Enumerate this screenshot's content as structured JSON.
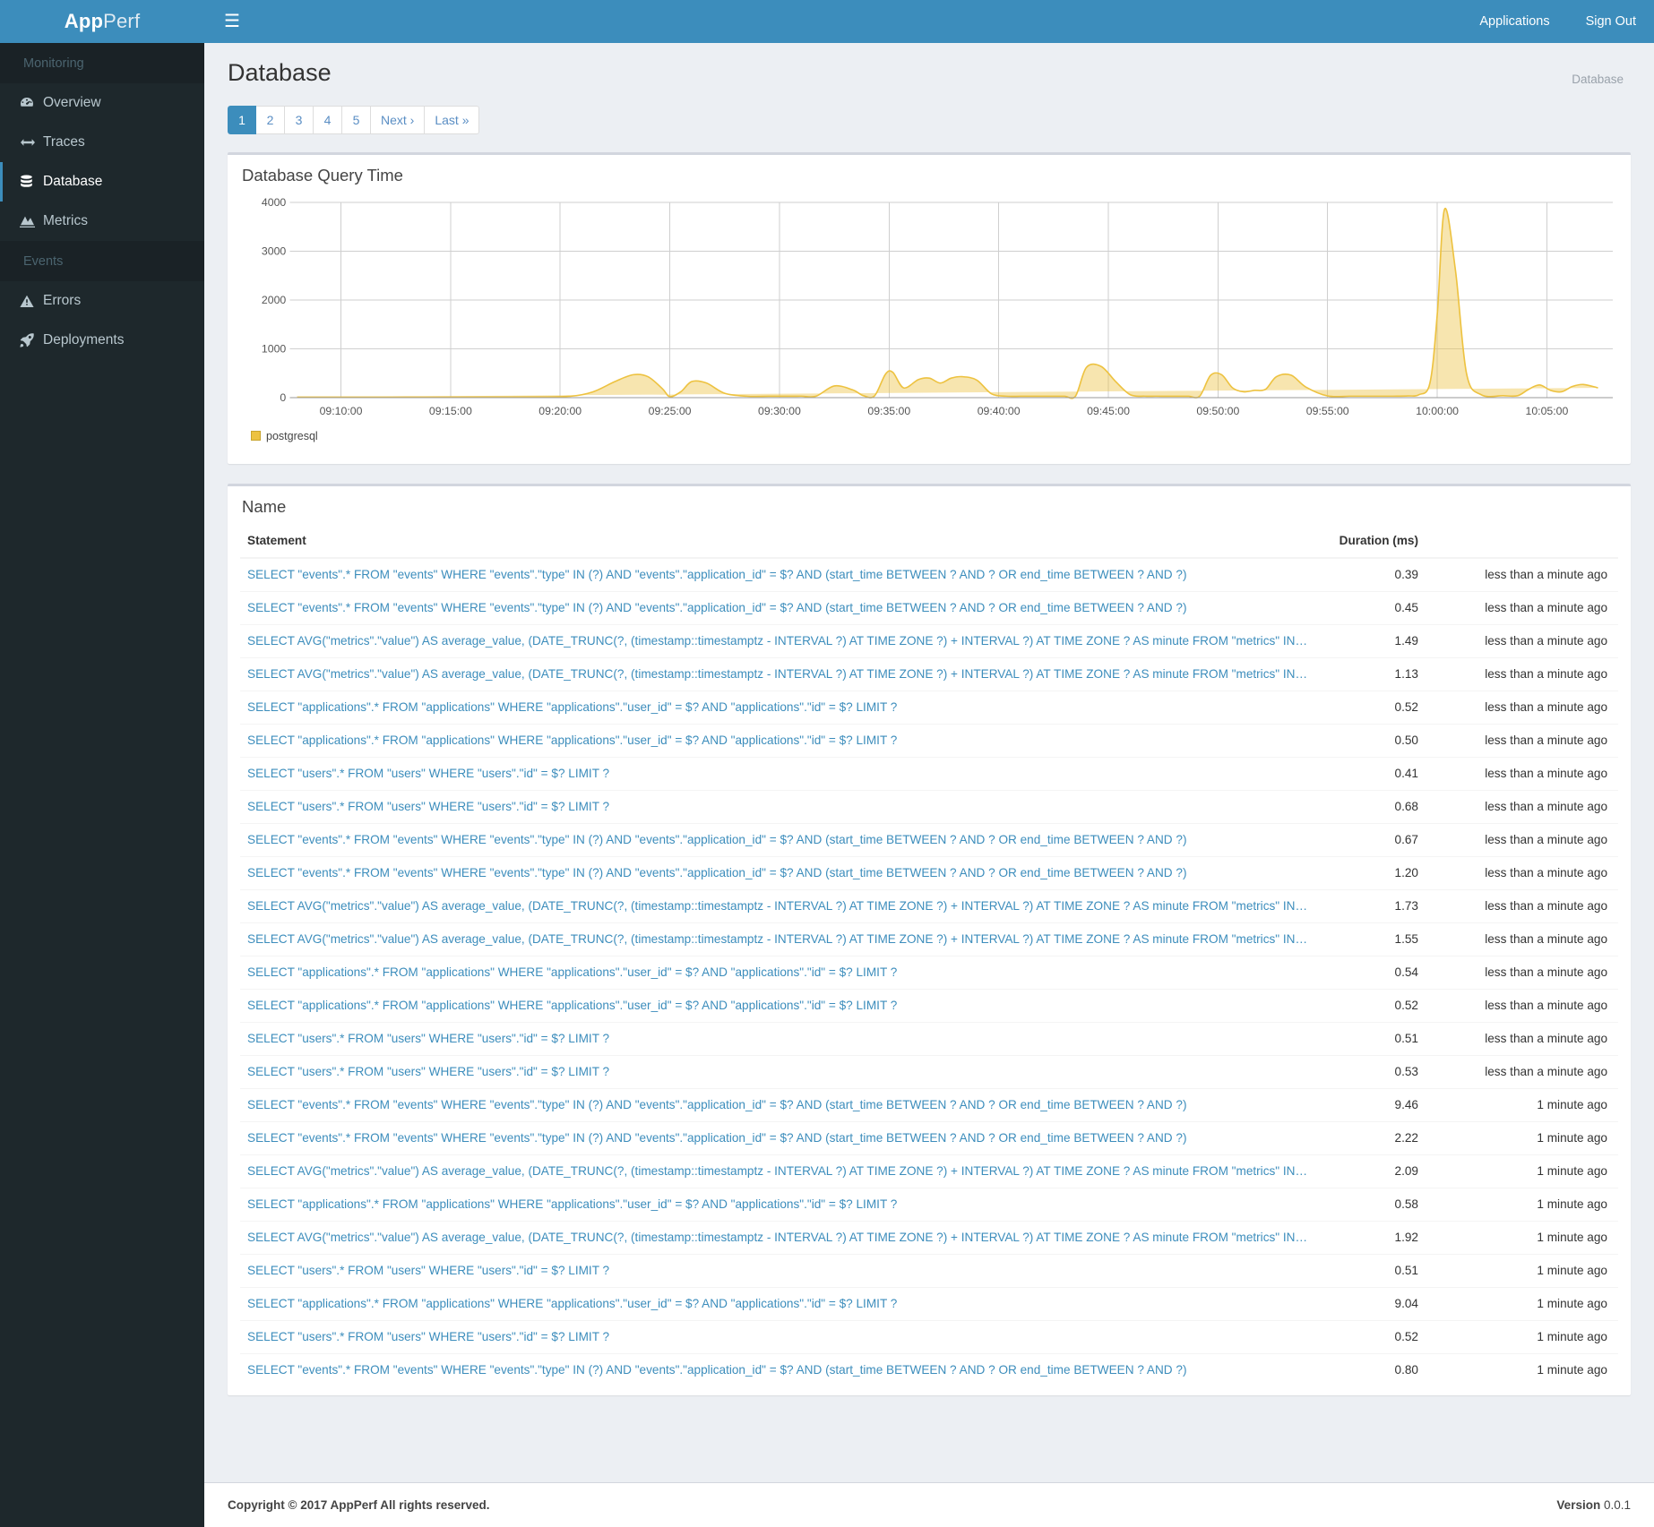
{
  "brand": {
    "strong": "App",
    "light": "Perf"
  },
  "topbar": {
    "menu_icon": "hamburger-icon",
    "links": [
      {
        "label": "Applications"
      },
      {
        "label": "Sign Out"
      }
    ]
  },
  "sidebar": {
    "sections": [
      {
        "header": "Monitoring",
        "items": [
          {
            "label": "Overview",
            "icon": "dashboard-icon",
            "active": false
          },
          {
            "label": "Traces",
            "icon": "arrows-h-icon",
            "active": false
          },
          {
            "label": "Database",
            "icon": "database-icon",
            "active": true
          },
          {
            "label": "Metrics",
            "icon": "area-chart-icon",
            "active": false
          }
        ]
      },
      {
        "header": "Events",
        "items": [
          {
            "label": "Errors",
            "icon": "warning-icon",
            "active": false
          },
          {
            "label": "Deployments",
            "icon": "rocket-icon",
            "active": false
          }
        ]
      }
    ]
  },
  "page": {
    "title": "Database",
    "breadcrumb": "Database"
  },
  "pagination": {
    "items": [
      {
        "label": "1",
        "active": true
      },
      {
        "label": "2",
        "active": false
      },
      {
        "label": "3",
        "active": false
      },
      {
        "label": "4",
        "active": false
      },
      {
        "label": "5",
        "active": false
      },
      {
        "label": "Next ›",
        "active": false
      },
      {
        "label": "Last »",
        "active": false
      }
    ]
  },
  "chart_box": {
    "title": "Database Query Time"
  },
  "table_box": {
    "title": "Name"
  },
  "colors": {
    "brand_blue": "#3c8dbc",
    "sidebar_dark": "#1e282c",
    "sidebar_header": "#1a2226",
    "series_fill": "#f7e3a6",
    "series_line": "#edc240",
    "link_blue": "#3c8dbc"
  },
  "chart_data": {
    "type": "area",
    "title": "Database Query Time",
    "xlabel": "",
    "ylabel": "",
    "ylim": [
      0,
      4000
    ],
    "yticks": [
      0,
      1000,
      2000,
      3000,
      4000
    ],
    "grid": true,
    "legend_position": "bottom-left",
    "xticks": [
      "09:10:00",
      "09:15:00",
      "09:20:00",
      "09:25:00",
      "09:30:00",
      "09:35:00",
      "09:40:00",
      "09:45:00",
      "09:50:00",
      "09:55:00",
      "10:00:00",
      "10:05:00"
    ],
    "series": [
      {
        "name": "postgresql",
        "color": "#edc240",
        "x": [
          "09:08:00",
          "09:09:30",
          "09:11:00",
          "09:13:00",
          "09:15:00",
          "09:17:00",
          "09:19:00",
          "09:20:30",
          "09:21:30",
          "09:22:30",
          "09:23:20",
          "09:24:00",
          "09:24:40",
          "09:25:00",
          "09:25:30",
          "09:26:00",
          "09:26:40",
          "09:27:30",
          "09:28:30",
          "09:29:30",
          "09:30:20",
          "09:31:00",
          "09:31:40",
          "09:32:30",
          "09:33:20",
          "09:33:50",
          "09:34:20",
          "09:34:50",
          "09:35:10",
          "09:35:40",
          "09:36:20",
          "09:36:50",
          "09:37:20",
          "09:37:50",
          "09:38:20",
          "09:39:00",
          "09:39:40",
          "09:40:20",
          "09:41:00",
          "09:41:40",
          "09:42:20",
          "09:43:00",
          "09:43:30",
          "09:44:00",
          "09:44:40",
          "09:45:20",
          "09:46:00",
          "09:46:40",
          "09:47:10",
          "09:47:40",
          "09:48:10",
          "09:48:40",
          "09:49:10",
          "09:49:40",
          "09:50:10",
          "09:50:40",
          "09:51:10",
          "09:51:40",
          "09:52:10",
          "09:52:40",
          "09:53:20",
          "09:54:00",
          "09:55:00",
          "09:56:00",
          "09:57:00",
          "09:58:00",
          "09:58:40",
          "09:59:10",
          "09:59:40",
          "10:00:00",
          "10:00:20",
          "10:00:50",
          "10:01:20",
          "10:02:00",
          "10:03:00",
          "10:03:40",
          "10:04:10",
          "10:04:40",
          "10:05:10",
          "10:05:40",
          "10:06:10",
          "10:06:40",
          "10:07:20",
          "10:08:00"
        ],
        "values": [
          10,
          10,
          10,
          12,
          12,
          12,
          14,
          30,
          120,
          330,
          470,
          430,
          180,
          20,
          120,
          330,
          300,
          90,
          30,
          28,
          28,
          30,
          30,
          240,
          160,
          40,
          35,
          480,
          520,
          200,
          370,
          400,
          300,
          400,
          430,
          360,
          80,
          30,
          28,
          28,
          28,
          28,
          30,
          620,
          640,
          330,
          60,
          30,
          30,
          28,
          28,
          28,
          30,
          460,
          470,
          200,
          120,
          150,
          170,
          430,
          460,
          220,
          35,
          30,
          30,
          30,
          35,
          60,
          300,
          1700,
          3860,
          2600,
          500,
          60,
          40,
          40,
          170,
          260,
          150,
          120,
          230,
          270,
          200,
          120,
          70
        ]
      }
    ]
  },
  "table": {
    "columns": [
      {
        "key": "statement",
        "label": "Statement",
        "align": "left"
      },
      {
        "key": "duration",
        "label": "Duration (ms)",
        "align": "right"
      },
      {
        "key": "when",
        "label": "",
        "align": "right"
      }
    ],
    "rows": [
      {
        "statement": "SELECT \"events\".* FROM \"events\" WHERE \"events\".\"type\" IN (?) AND \"events\".\"application_id\" = $? AND (start_time BETWEEN ? AND ? OR end_time BETWEEN ? AND ?)",
        "duration": "0.39",
        "when": "less than a minute ago"
      },
      {
        "statement": "SELECT \"events\".* FROM \"events\" WHERE \"events\".\"type\" IN (?) AND \"events\".\"application_id\" = $? AND (start_time BETWEEN ? AND ? OR end_time BETWEEN ? AND ?)",
        "duration": "0.45",
        "when": "less than a minute ago"
      },
      {
        "statement": "SELECT AVG(\"metrics\".\"value\") AS average_value, (DATE_TRUNC(?, (timestamp::timestamptz - INTERVAL ?) AT TIME ZONE ?) + INTERVAL ?) AT TIME ZONE ? AS minute FROM \"metrics\" INNER JOIN \"hosts\" ON…",
        "duration": "1.49",
        "when": "less than a minute ago"
      },
      {
        "statement": "SELECT AVG(\"metrics\".\"value\") AS average_value, (DATE_TRUNC(?, (timestamp::timestamptz - INTERVAL ?) AT TIME ZONE ?) + INTERVAL ?) AT TIME ZONE ? AS minute FROM \"metrics\" INNER JOIN \"hosts\" ON…",
        "duration": "1.13",
        "when": "less than a minute ago"
      },
      {
        "statement": "SELECT \"applications\".* FROM \"applications\" WHERE \"applications\".\"user_id\" = $? AND \"applications\".\"id\" = $? LIMIT ?",
        "duration": "0.52",
        "when": "less than a minute ago"
      },
      {
        "statement": "SELECT \"applications\".* FROM \"applications\" WHERE \"applications\".\"user_id\" = $? AND \"applications\".\"id\" = $? LIMIT ?",
        "duration": "0.50",
        "when": "less than a minute ago"
      },
      {
        "statement": "SELECT \"users\".* FROM \"users\" WHERE \"users\".\"id\" = $? LIMIT ?",
        "duration": "0.41",
        "when": "less than a minute ago"
      },
      {
        "statement": "SELECT \"users\".* FROM \"users\" WHERE \"users\".\"id\" = $? LIMIT ?",
        "duration": "0.68",
        "when": "less than a minute ago"
      },
      {
        "statement": "SELECT \"events\".* FROM \"events\" WHERE \"events\".\"type\" IN (?) AND \"events\".\"application_id\" = $? AND (start_time BETWEEN ? AND ? OR end_time BETWEEN ? AND ?)",
        "duration": "0.67",
        "when": "less than a minute ago"
      },
      {
        "statement": "SELECT \"events\".* FROM \"events\" WHERE \"events\".\"type\" IN (?) AND \"events\".\"application_id\" = $? AND (start_time BETWEEN ? AND ? OR end_time BETWEEN ? AND ?)",
        "duration": "1.20",
        "when": "less than a minute ago"
      },
      {
        "statement": "SELECT AVG(\"metrics\".\"value\") AS average_value, (DATE_TRUNC(?, (timestamp::timestamptz - INTERVAL ?) AT TIME ZONE ?) + INTERVAL ?) AT TIME ZONE ? AS minute FROM \"metrics\" INNER JOIN \"hosts\" ON…",
        "duration": "1.73",
        "when": "less than a minute ago"
      },
      {
        "statement": "SELECT AVG(\"metrics\".\"value\") AS average_value, (DATE_TRUNC(?, (timestamp::timestamptz - INTERVAL ?) AT TIME ZONE ?) + INTERVAL ?) AT TIME ZONE ? AS minute FROM \"metrics\" INNER JOIN \"hosts\" ON…",
        "duration": "1.55",
        "when": "less than a minute ago"
      },
      {
        "statement": "SELECT \"applications\".* FROM \"applications\" WHERE \"applications\".\"user_id\" = $? AND \"applications\".\"id\" = $? LIMIT ?",
        "duration": "0.54",
        "when": "less than a minute ago"
      },
      {
        "statement": "SELECT \"applications\".* FROM \"applications\" WHERE \"applications\".\"user_id\" = $? AND \"applications\".\"id\" = $? LIMIT ?",
        "duration": "0.52",
        "when": "less than a minute ago"
      },
      {
        "statement": "SELECT \"users\".* FROM \"users\" WHERE \"users\".\"id\" = $? LIMIT ?",
        "duration": "0.51",
        "when": "less than a minute ago"
      },
      {
        "statement": "SELECT \"users\".* FROM \"users\" WHERE \"users\".\"id\" = $? LIMIT ?",
        "duration": "0.53",
        "when": "less than a minute ago"
      },
      {
        "statement": "SELECT \"events\".* FROM \"events\" WHERE \"events\".\"type\" IN (?) AND \"events\".\"application_id\" = $? AND (start_time BETWEEN ? AND ? OR end_time BETWEEN ? AND ?)",
        "duration": "9.46",
        "when": "1 minute ago"
      },
      {
        "statement": "SELECT \"events\".* FROM \"events\" WHERE \"events\".\"type\" IN (?) AND \"events\".\"application_id\" = $? AND (start_time BETWEEN ? AND ? OR end_time BETWEEN ? AND ?)",
        "duration": "2.22",
        "when": "1 minute ago"
      },
      {
        "statement": "SELECT AVG(\"metrics\".\"value\") AS average_value, (DATE_TRUNC(?, (timestamp::timestamptz - INTERVAL ?) AT TIME ZONE ?) + INTERVAL ?) AT TIME ZONE ? AS minute FROM \"metrics\" INNER JOIN \"hosts\" ON…",
        "duration": "2.09",
        "when": "1 minute ago"
      },
      {
        "statement": "SELECT \"applications\".* FROM \"applications\" WHERE \"applications\".\"user_id\" = $? AND \"applications\".\"id\" = $? LIMIT ?",
        "duration": "0.58",
        "when": "1 minute ago"
      },
      {
        "statement": "SELECT AVG(\"metrics\".\"value\") AS average_value, (DATE_TRUNC(?, (timestamp::timestamptz - INTERVAL ?) AT TIME ZONE ?) + INTERVAL ?) AT TIME ZONE ? AS minute FROM \"metrics\" INNER JOIN \"hosts\" ON…",
        "duration": "1.92",
        "when": "1 minute ago"
      },
      {
        "statement": "SELECT \"users\".* FROM \"users\" WHERE \"users\".\"id\" = $? LIMIT ?",
        "duration": "0.51",
        "when": "1 minute ago"
      },
      {
        "statement": "SELECT \"applications\".* FROM \"applications\" WHERE \"applications\".\"user_id\" = $? AND \"applications\".\"id\" = $? LIMIT ?",
        "duration": "9.04",
        "when": "1 minute ago"
      },
      {
        "statement": "SELECT \"users\".* FROM \"users\" WHERE \"users\".\"id\" = $? LIMIT ?",
        "duration": "0.52",
        "when": "1 minute ago"
      },
      {
        "statement": "SELECT \"events\".* FROM \"events\" WHERE \"events\".\"type\" IN (?) AND \"events\".\"application_id\" = $? AND (start_time BETWEEN ? AND ? OR end_time BETWEEN ? AND ?)",
        "duration": "0.80",
        "when": "1 minute ago"
      }
    ]
  },
  "footer": {
    "copyright_strong": "Copyright © 2017 AppPerf All rights reserved.",
    "version_label": "Version",
    "version_number": "0.0.1"
  }
}
